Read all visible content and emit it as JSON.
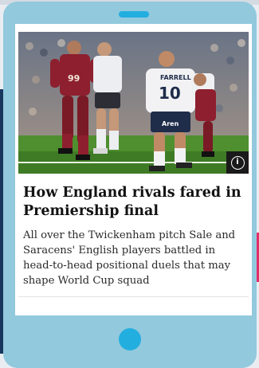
{
  "article": {
    "headline": "How England rivals fared in Premiership final",
    "standfirst": "All over the Twickenham pitch Sale and Saracens' English players battled in head-to-head positional duels that may shape World Cup squad",
    "photo": {
      "shirt_number_front": "10",
      "shirt_name": "FARRELL",
      "shirt_number_red": "99",
      "sponsor": "Aren"
    }
  },
  "icons": {
    "info": "info-icon",
    "info_glyph": "i"
  },
  "colors": {
    "phone": "#92c9dd",
    "accent": "#23aee0",
    "sidebar": "#17375e",
    "highlight": "#e52d6a"
  }
}
